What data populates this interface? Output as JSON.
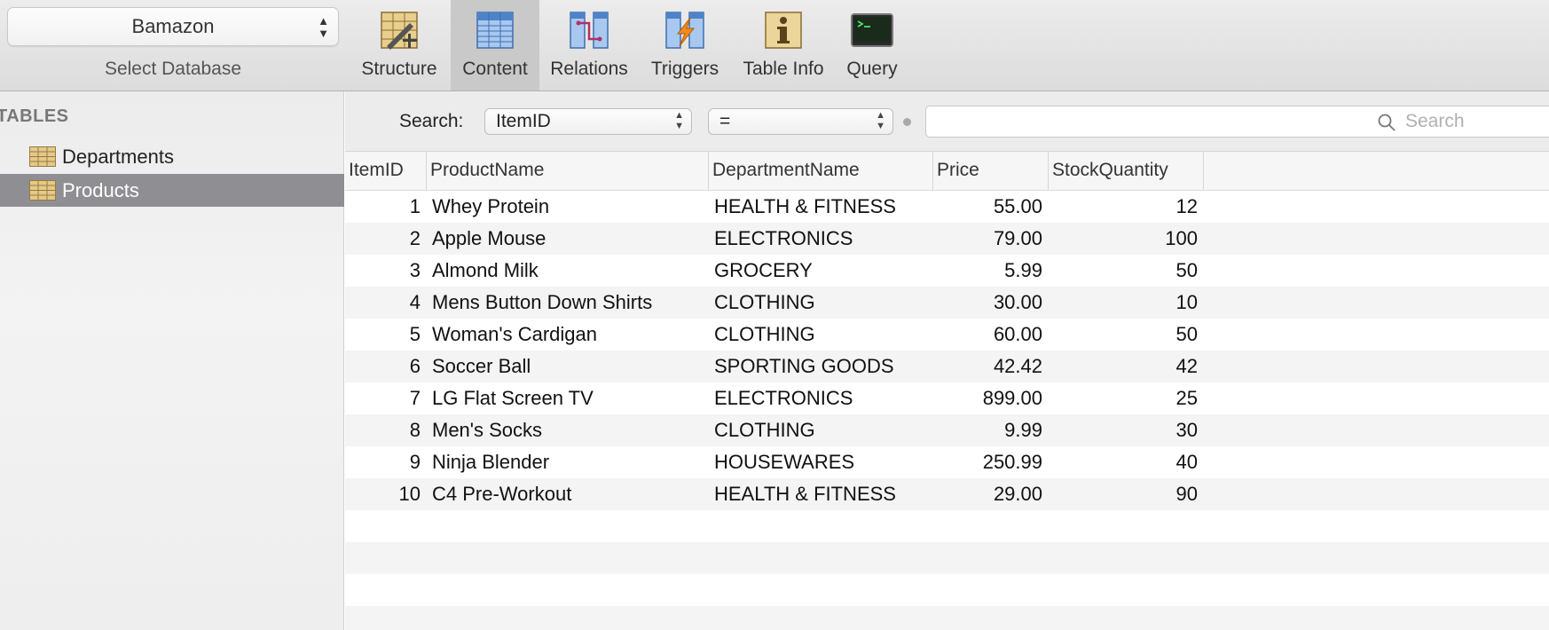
{
  "database": {
    "selected": "Bamazon",
    "label": "Select Database"
  },
  "toolbar": {
    "buttons": [
      {
        "label": "Structure",
        "icon": "structure-icon",
        "active": false
      },
      {
        "label": "Content",
        "icon": "content-icon",
        "active": true
      },
      {
        "label": "Relations",
        "icon": "relations-icon",
        "active": false
      },
      {
        "label": "Triggers",
        "icon": "triggers-icon",
        "active": false
      },
      {
        "label": "Table Info",
        "icon": "table-info-icon",
        "active": false
      },
      {
        "label": "Query",
        "icon": "query-icon",
        "active": false
      }
    ]
  },
  "sidebar": {
    "heading": "TABLES",
    "items": [
      {
        "label": "Departments",
        "selected": false
      },
      {
        "label": "Products",
        "selected": true
      }
    ]
  },
  "search": {
    "label": "Search:",
    "field": "ItemID",
    "operator": "=",
    "value": "",
    "placeholder": "Search"
  },
  "table": {
    "columns": [
      "ItemID",
      "ProductName",
      "DepartmentName",
      "Price",
      "StockQuantity"
    ],
    "rows": [
      [
        "1",
        "Whey Protein",
        "HEALTH & FITNESS",
        "55.00",
        "12"
      ],
      [
        "2",
        "Apple Mouse",
        "ELECTRONICS",
        "79.00",
        "100"
      ],
      [
        "3",
        "Almond Milk",
        "GROCERY",
        "5.99",
        "50"
      ],
      [
        "4",
        "Mens Button Down Shirts",
        "CLOTHING",
        "30.00",
        "10"
      ],
      [
        "5",
        "Woman's Cardigan",
        "CLOTHING",
        "60.00",
        "50"
      ],
      [
        "6",
        "Soccer Ball",
        "SPORTING GOODS",
        "42.42",
        "42"
      ],
      [
        "7",
        "LG Flat Screen TV",
        "ELECTRONICS",
        "899.00",
        "25"
      ],
      [
        "8",
        "Men's Socks",
        "CLOTHING",
        "9.99",
        "30"
      ],
      [
        "9",
        "Ninja Blender",
        "HOUSEWARES",
        "250.99",
        "40"
      ],
      [
        "10",
        "C4 Pre-Workout",
        "HEALTH & FITNESS",
        "29.00",
        "90"
      ]
    ]
  },
  "colors": {
    "selected_sidebar": "#8f8f93",
    "active_tool": "#c9c9c9",
    "table_icon": "#e3c98a"
  }
}
